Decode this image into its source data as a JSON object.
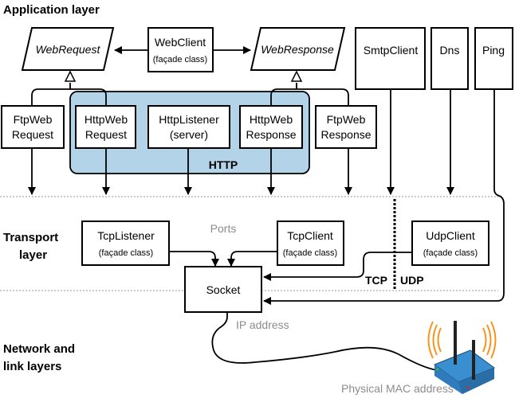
{
  "layers": {
    "application": "Application layer",
    "transport": [
      "Transport",
      "layer"
    ],
    "network": [
      "Network and",
      "link layers"
    ]
  },
  "app": {
    "web_request": "WebRequest",
    "web_client": [
      "WebClient",
      "(façade class)"
    ],
    "web_response": "WebResponse",
    "smtp_client": "SmtpClient",
    "dns": "Dns",
    "ping": "Ping",
    "ftp_web_request": [
      "FtpWeb",
      "Request"
    ],
    "http_web_request": [
      "HttpWeb",
      "Request"
    ],
    "http_listener": [
      "HttpListener",
      "(server)"
    ],
    "http_web_response": [
      "HttpWeb",
      "Response"
    ],
    "ftp_web_response": [
      "FtpWeb",
      "Response"
    ],
    "http_group": "HTTP",
    "http_group_color": "#b3d4e8"
  },
  "transport": {
    "tcp_listener": [
      "TcpListener",
      "(façade class)"
    ],
    "tcp_client": [
      "TcpClient",
      "(façade class)"
    ],
    "udp_client": [
      "UdpClient",
      "(façade class)"
    ],
    "socket": "Socket",
    "ports": "Ports",
    "tcp": "TCP",
    "udp": "UDP"
  },
  "network": {
    "ip_address": "IP address",
    "mac_address": "Physical MAC address",
    "router_color": "#3a8fd0",
    "signal_color": "#f7941d"
  }
}
